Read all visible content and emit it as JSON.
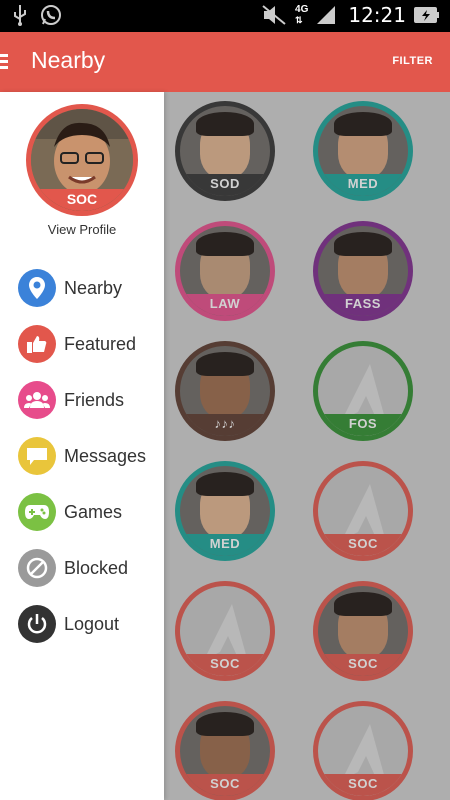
{
  "status_bar": {
    "time": "12:21",
    "network": "4G"
  },
  "app_bar": {
    "title": "Nearby",
    "filter_label": "FILTER"
  },
  "profile": {
    "tag": "SOC",
    "view_profile_label": "View Profile",
    "ring_color": "#e2574c"
  },
  "menu": [
    {
      "label": "Nearby",
      "icon": "location-pin-icon",
      "color": "#3b82d9"
    },
    {
      "label": "Featured",
      "icon": "thumbs-up-icon",
      "color": "#e2574c"
    },
    {
      "label": "Friends",
      "icon": "people-icon",
      "color": "#e74c8b"
    },
    {
      "label": "Messages",
      "icon": "chat-bubble-icon",
      "color": "#e9c53b"
    },
    {
      "label": "Games",
      "icon": "gamepad-icon",
      "color": "#7bc143"
    },
    {
      "label": "Blocked",
      "icon": "blocked-icon",
      "color": "#9a9a9a"
    },
    {
      "label": "Logout",
      "icon": "power-icon",
      "color": "#333333"
    }
  ],
  "grid": [
    {
      "label": "SOD",
      "color": "#333333",
      "photo": true
    },
    {
      "label": "MED",
      "color": "#1aa59a",
      "photo": true
    },
    {
      "label": "LAW",
      "color": "#e74c8b",
      "photo": true
    },
    {
      "label": "FASS",
      "color": "#7e2a8e",
      "photo": true
    },
    {
      "label": "♪♪♪",
      "color": "#5b3a2e",
      "photo": true
    },
    {
      "label": "FOS",
      "color": "#2f8f2f",
      "photo": false
    },
    {
      "label": "MED",
      "color": "#1aa59a",
      "photo": true
    },
    {
      "label": "SOC",
      "color": "#e2574c",
      "photo": false
    },
    {
      "label": "SOC",
      "color": "#e2574c",
      "photo": false
    },
    {
      "label": "SOC",
      "color": "#e2574c",
      "photo": true
    },
    {
      "label": "SOC",
      "color": "#e2574c",
      "photo": true
    },
    {
      "label": "SOC",
      "color": "#e2574c",
      "photo": false
    }
  ]
}
